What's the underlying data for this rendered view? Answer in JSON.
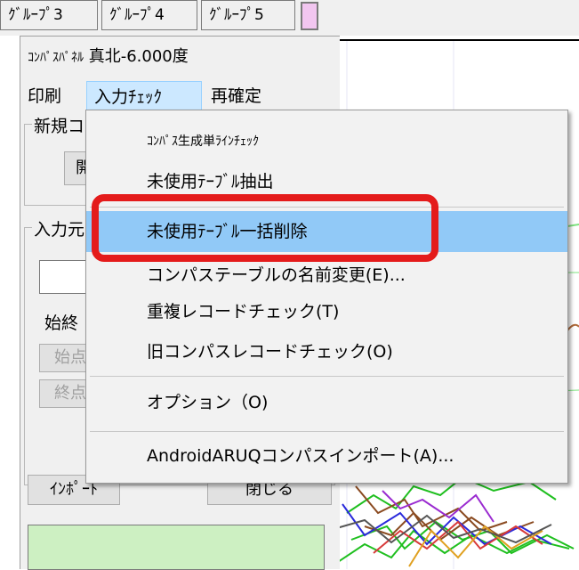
{
  "top_groups": [
    {
      "label": "ｸﾞﾙｰﾌﾟ3"
    },
    {
      "label": "ｸﾞﾙｰﾌﾟ4"
    },
    {
      "label": "ｸﾞﾙｰﾌﾟ5"
    }
  ],
  "panel": {
    "title_prefix": "ｺﾝﾊﾟｽﾊﾟﾈﾙ",
    "title_value": "真北-6.000度",
    "menu": {
      "print": "印刷",
      "input_check": "入力ﾁｪｯｸ",
      "reconfirm": "再確定"
    },
    "new_group_label": "新規コ",
    "new_button_label": "開",
    "input_group_label": "入力元",
    "start_end_label": "始終",
    "start_button": "始点",
    "end_button": "終点",
    "import_button": "ｲﾝﾎﾟｰﾄ",
    "close_button": "閉じる"
  },
  "dropdown": {
    "items": [
      {
        "label": "ｺﾝﾊﾟｽ生成単ﾗｲﾝﾁｪｯｸ"
      },
      {
        "label": "未使用ﾃｰﾌﾞﾙ抽出"
      },
      {
        "label": "未使用ﾃｰﾌﾞﾙ一括削除"
      },
      {
        "label": "コンパステーブルの名前変更(E)..."
      },
      {
        "label": "重複レコードチェック(T)"
      },
      {
        "label": "旧コンパスレコードチェック(O)"
      },
      {
        "label": "オプション（O)"
      },
      {
        "label": "AndroidARUQコンパスインポート(A)..."
      }
    ]
  },
  "colors": {
    "highlight": "#91c9f7",
    "annotation_red": "#e41b1b",
    "swatch": "#f2c6f0",
    "green_box": "#cdf0c2"
  }
}
